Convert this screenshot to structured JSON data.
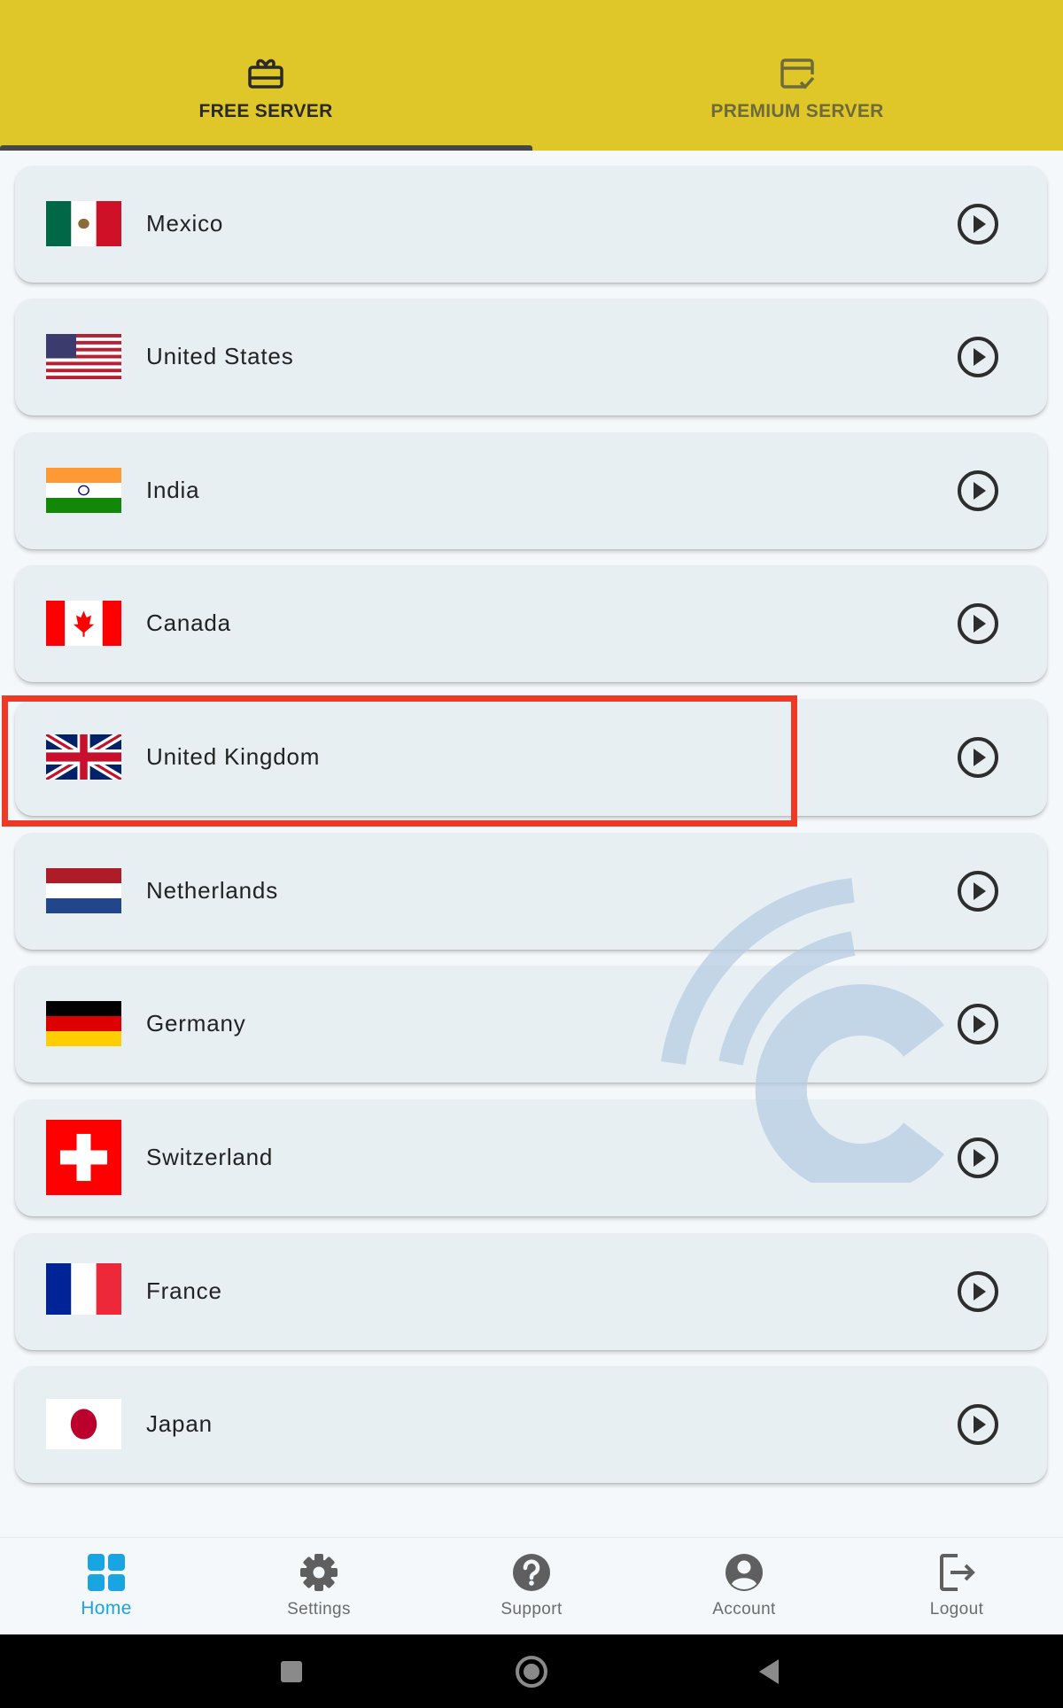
{
  "tabs": [
    {
      "label": "FREE SERVER",
      "icon": "gift-card-icon",
      "active": true
    },
    {
      "label": "PREMIUM SERVER",
      "icon": "premium-card-icon",
      "active": false
    }
  ],
  "servers": [
    {
      "name": "Mexico",
      "flag": "mexico-flag"
    },
    {
      "name": "United States",
      "flag": "us-flag"
    },
    {
      "name": "India",
      "flag": "india-flag"
    },
    {
      "name": "Canada",
      "flag": "canada-flag"
    },
    {
      "name": "United Kingdom",
      "flag": "uk-flag",
      "highlighted": true
    },
    {
      "name": "Netherlands",
      "flag": "netherlands-flag"
    },
    {
      "name": "Germany",
      "flag": "germany-flag"
    },
    {
      "name": "Switzerland",
      "flag": "switzerland-flag"
    },
    {
      "name": "France",
      "flag": "france-flag"
    },
    {
      "name": "Japan",
      "flag": "japan-flag"
    }
  ],
  "bottom_nav": [
    {
      "label": "Home",
      "icon": "home-grid-icon",
      "active": true
    },
    {
      "label": "Settings",
      "icon": "gear-icon",
      "active": false
    },
    {
      "label": "Support",
      "icon": "help-icon",
      "active": false
    },
    {
      "label": "Account",
      "icon": "account-icon",
      "active": false
    },
    {
      "label": "Logout",
      "icon": "logout-icon",
      "active": false
    }
  ],
  "system_nav": [
    "recents-button",
    "home-button",
    "back-button"
  ],
  "colors": {
    "header": "#dfc72a",
    "card": "#e8eff3",
    "highlight": "#ee3a24",
    "nav_active": "#19a5e1",
    "watermark": "#b5cde5"
  }
}
